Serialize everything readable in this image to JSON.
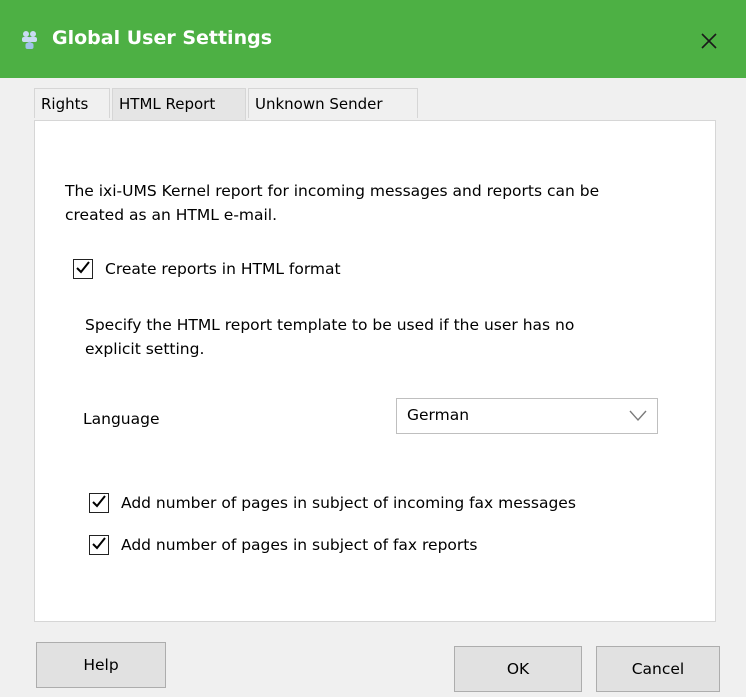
{
  "window": {
    "title": "Global User Settings",
    "title_icon": "users-icon",
    "close_icon": "close-icon",
    "titlebar_color": "#4db044"
  },
  "tabs": [
    {
      "label": "Rights",
      "active": false
    },
    {
      "label": "HTML Report",
      "active": true
    },
    {
      "label": "Unknown Sender",
      "active": false
    }
  ],
  "panel": {
    "intro_line1": "The ixi-UMS Kernel report for incoming messages and reports can be",
    "intro_line2": "created as an HTML e-mail.",
    "create_reports": {
      "label": "Create reports in HTML format",
      "checked": true
    },
    "template_line1": "Specify the HTML report template to be used if the user has no",
    "template_line2": "explicit setting.",
    "language": {
      "label": "Language",
      "value": "German"
    },
    "add_pages_incoming": {
      "label": "Add number of pages in subject of incoming fax messages",
      "checked": true
    },
    "add_pages_reports": {
      "label": "Add number of pages in subject of fax reports",
      "checked": true
    }
  },
  "buttons": {
    "help": "Help",
    "ok": "OK",
    "cancel": "Cancel"
  }
}
